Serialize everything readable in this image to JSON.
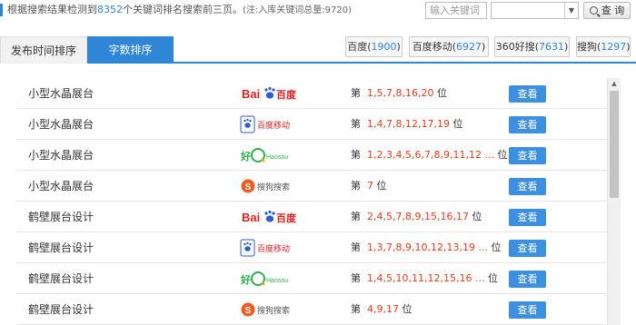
{
  "header": {
    "summary_prefix": "根据搜索结果检测到",
    "summary_count": "8352",
    "summary_suffix": "个关键词排名搜索前三页。",
    "summary_note": "(注:入库关键词总量:9720)",
    "keyword_placeholder": "输入关键词",
    "query_label": "查 询"
  },
  "tabs": [
    {
      "label": "发布时间排序",
      "active": false
    },
    {
      "label": "字数排序",
      "active": true
    }
  ],
  "engines": [
    {
      "name": "百度",
      "count": "1900"
    },
    {
      "name": "百度移动",
      "count": "6927"
    },
    {
      "name": "360好搜",
      "count": "7631"
    },
    {
      "name": "搜狗",
      "count": "1297"
    }
  ],
  "rank_prefix": "第",
  "rank_suffix": "位",
  "view_label": "查看",
  "logo_text": {
    "baidu": "百度",
    "baidu_mobile": "百度移动",
    "haosou": "Haosou",
    "sogou": "搜狗搜索"
  },
  "rows": [
    {
      "keyword": "小型水晶展台",
      "engine": "baidu",
      "positions": "1,5,7,8,16,20"
    },
    {
      "keyword": "小型水晶展台",
      "engine": "baidu-mobile",
      "positions": "1,4,7,8,12,17,19"
    },
    {
      "keyword": "小型水晶展台",
      "engine": "haosou",
      "positions": "1,2,3,4,5,6,7,8,9,11,12 ..."
    },
    {
      "keyword": "小型水晶展台",
      "engine": "sogou",
      "positions": "7"
    },
    {
      "keyword": "鹤壁展台设计",
      "engine": "baidu",
      "positions": "2,4,5,7,8,9,15,16,17"
    },
    {
      "keyword": "鹤壁展台设计",
      "engine": "baidu-mobile",
      "positions": "1,3,7,8,9,10,12,13,19 ..."
    },
    {
      "keyword": "鹤壁展台设计",
      "engine": "haosou",
      "positions": "1,4,5,10,11,12,15,16 ..."
    },
    {
      "keyword": "鹤壁展台设计",
      "engine": "sogou",
      "positions": "4,9,17"
    }
  ],
  "colors": {
    "accent": "#2f86d6",
    "rank_numbers": "#e0401f",
    "view_button": "#3d8fe0"
  }
}
